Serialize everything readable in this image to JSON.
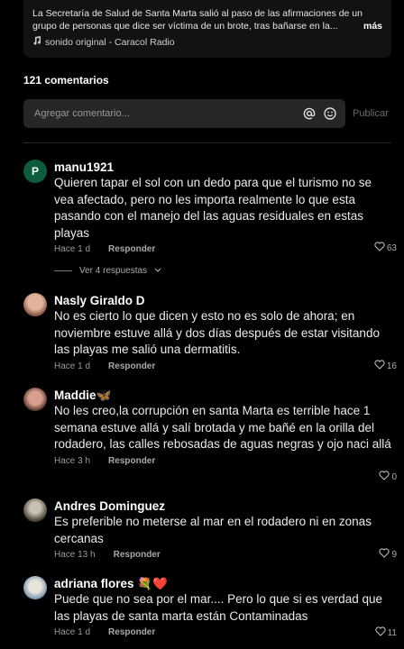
{
  "caption": {
    "line1": "La Secretaría de Salud de Santa Marta salió al paso de las afirmaciones de un",
    "line2": "grupo de personas que dice ser víctima de un brote, tras bañarse en la...",
    "more": "más",
    "sound": "sonido original - Caracol Radio"
  },
  "comments_count": "121 comentarios",
  "comment_input": {
    "placeholder": "Agregar comentario..."
  },
  "publish_label": "Publicar",
  "reply_label": "Responder",
  "view_replies": "Ver 4 respuestas",
  "comments": [
    {
      "user": "manu1921",
      "initial": "P",
      "avatar_color": "#0c5d3c",
      "text": "Quieren tapar el sol con un dedo para que el turismo no se vea afectado, pero no les importa realmente lo que esta pasando con el manejo del las aguas residuales en estas playas",
      "time": "Hace 1 d",
      "likes": "63"
    },
    {
      "user": "Nasly Giraldo D",
      "initial": "",
      "avatar_color": "#c9907a",
      "text": "No es cierto lo que dicen y esto no es solo de ahora; en noviembre estuve allá y dos días después de estar visitando las playas me salió una dermatitis.",
      "time": "Hace 1 d",
      "likes": "16"
    },
    {
      "user": "Maddie🦋",
      "initial": "",
      "avatar_color": "#b07a6a",
      "text": "No les creo,la corrupción en santa Marta es terrible hace 1 semana estuve allá y salí brotada y me bañé en la orilla del rodadero, las calles rebosadas de aguas negras y ojo naci allá",
      "time": "Hace 3 h",
      "likes": "0"
    },
    {
      "user": "Andres Dominguez",
      "initial": "",
      "avatar_color": "#7a7466",
      "text": "Es preferible no meterse al mar en el rodadero ni en zonas cercanas",
      "time": "Hace 13 h",
      "likes": "9"
    },
    {
      "user": "adriana flores 💐❤️",
      "initial": "",
      "avatar_color": "#9fb6c6",
      "text": "Puede que no sea por el mar.... Pero lo que si es verdad que las playas de santa marta están Contaminadas",
      "time": "Hace 1 d",
      "likes": "11"
    }
  ],
  "colors": {
    "background": "#000000",
    "input_bg": "#262626",
    "muted": "#9a9a9a"
  },
  "icons": [
    "music-note-icon",
    "at-sign-icon",
    "emoji-icon",
    "heart-icon",
    "chevron-down-icon"
  ]
}
